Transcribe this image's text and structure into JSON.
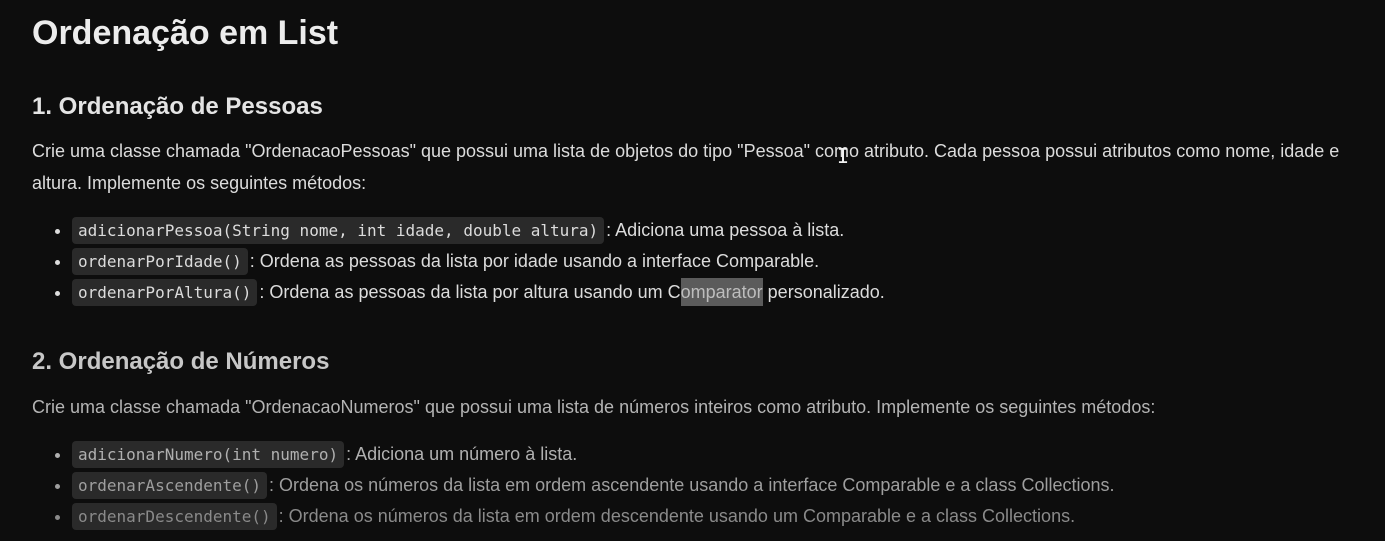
{
  "title": "Ordenação em List",
  "section1": {
    "heading": "1. Ordenação de Pessoas",
    "description": "Crie uma classe chamada \"OrdenacaoPessoas\" que possui uma lista de objetos do tipo \"Pessoa\" como atributo. Cada pessoa possui atributos como nome, idade e altura. Implemente os seguintes métodos:",
    "items": [
      {
        "code": "adicionarPessoa(String nome, int idade, double altura)",
        "text": ": Adiciona uma pessoa à lista."
      },
      {
        "code": "ordenarPorIdade()",
        "text": ": Ordena as pessoas da lista por idade usando a interface Comparable."
      },
      {
        "code": "ordenarPorAltura()",
        "text_before": ": Ordena as pessoas da lista por altura usando um C",
        "highlighted": "omparator",
        "text_after": " personalizado."
      }
    ]
  },
  "section2": {
    "heading": "2. Ordenação de Números",
    "description": "Crie uma classe chamada \"OrdenacaoNumeros\" que possui uma lista de números inteiros como atributo. Implemente os seguintes métodos:",
    "items": [
      {
        "code": "adicionarNumero(int numero)",
        "text": ": Adiciona um número à lista."
      },
      {
        "code": "ordenarAscendente()",
        "text": ": Ordena os números da lista em ordem ascendente usando a interface Comparable e a class Collections."
      },
      {
        "code": "ordenarDescendente()",
        "text": ": Ordena os números da lista em ordem descendente usando um Comparable e a class Collections."
      }
    ]
  },
  "cursor_icon": "text-cursor-icon"
}
